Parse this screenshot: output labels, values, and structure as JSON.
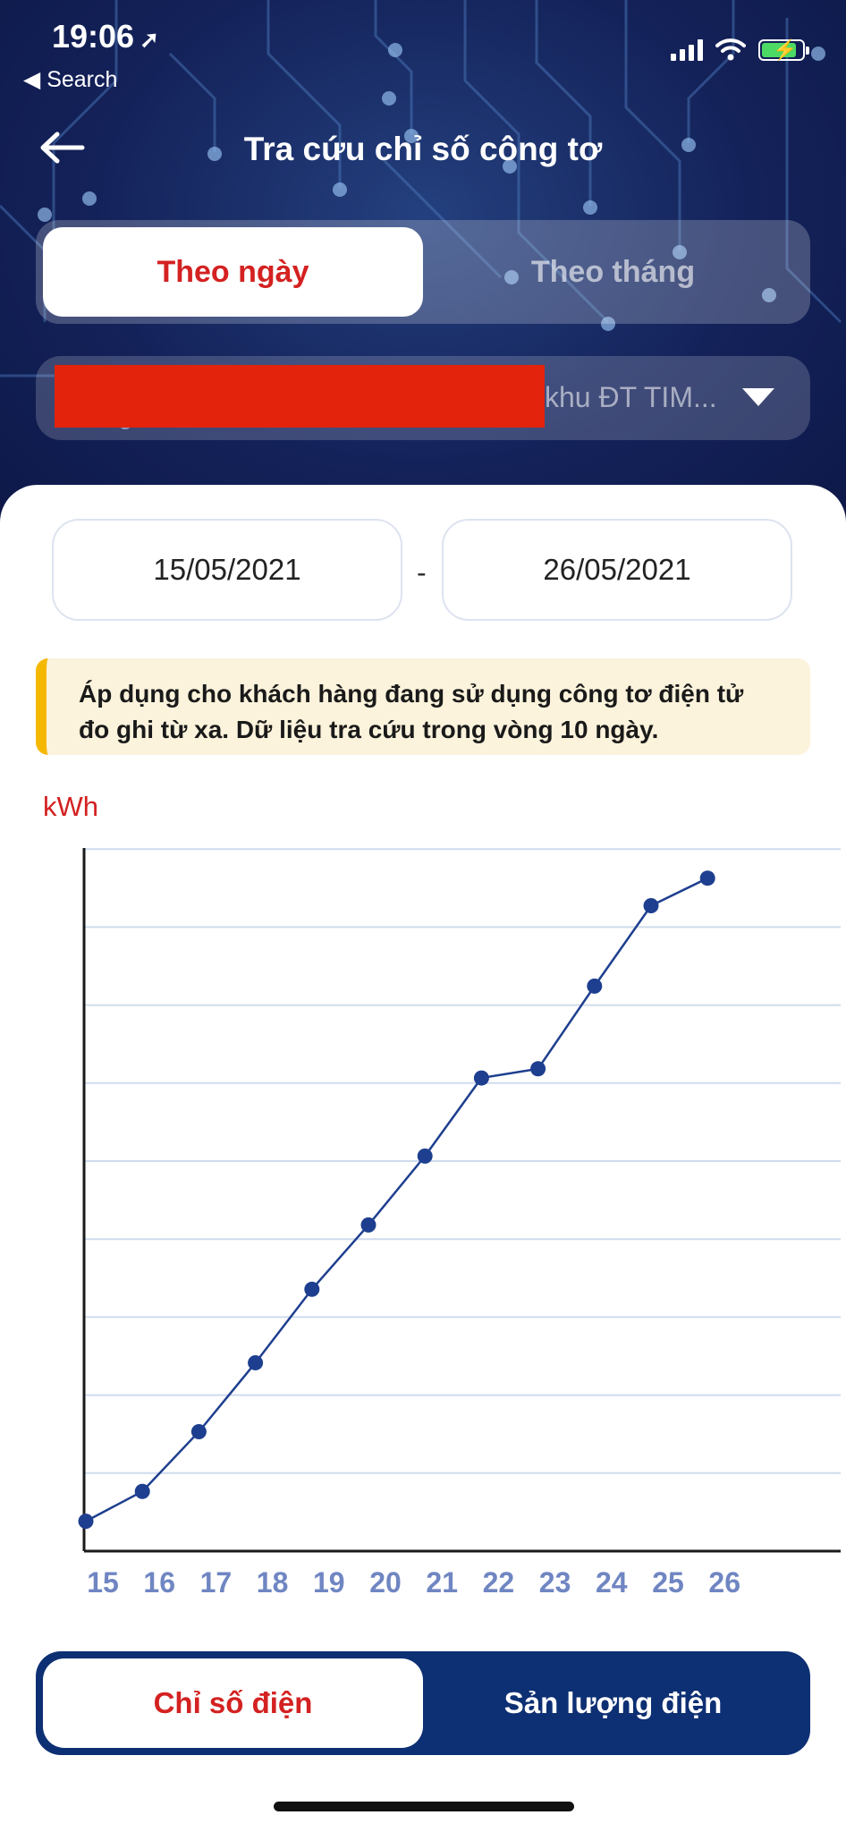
{
  "status_bar": {
    "time": "19:06",
    "back_app": "Search"
  },
  "header": {
    "title": "Tra cứu chỉ số công tơ"
  },
  "period_tabs": [
    {
      "label": "Theo ngày",
      "active": true
    },
    {
      "label": "Theo tháng",
      "active": false
    }
  ],
  "account": {
    "visible_text": "khu ĐT TIM..."
  },
  "date_range": {
    "from": "15/05/2021",
    "separator": "-",
    "to": "26/05/2021"
  },
  "notice": {
    "line1": "Áp dụng cho khách hàng đang sử dụng công tơ điện tử",
    "line2": "đo ghi từ xa. Dữ liệu tra cứu trong vòng 10 ngày."
  },
  "chart_data": {
    "type": "line",
    "ylabel": "kWh",
    "x": [
      "15",
      "16",
      "17",
      "18",
      "19",
      "20",
      "21",
      "22",
      "23",
      "24",
      "25",
      "26"
    ],
    "values": [
      0.65,
      1.3,
      2.6,
      4.1,
      5.7,
      7.1,
      8.6,
      10.3,
      10.5,
      12.3,
      14.05,
      14.65
    ],
    "ylim": [
      0,
      15
    ],
    "grid": true,
    "colors": {
      "line": "#1e3f8f",
      "point": "#1e3f8f",
      "grid": "#cfdced",
      "tick": "#6f86c2"
    }
  },
  "bottom_tabs": [
    {
      "label": "Chỉ số điện",
      "active": true
    },
    {
      "label": "Sản lượng điện",
      "active": false
    }
  ],
  "colors": {
    "accent_red": "#d42121",
    "navy": "#0d2f73",
    "notice_bg": "#fcf3dc",
    "notice_bar": "#f5b800"
  }
}
